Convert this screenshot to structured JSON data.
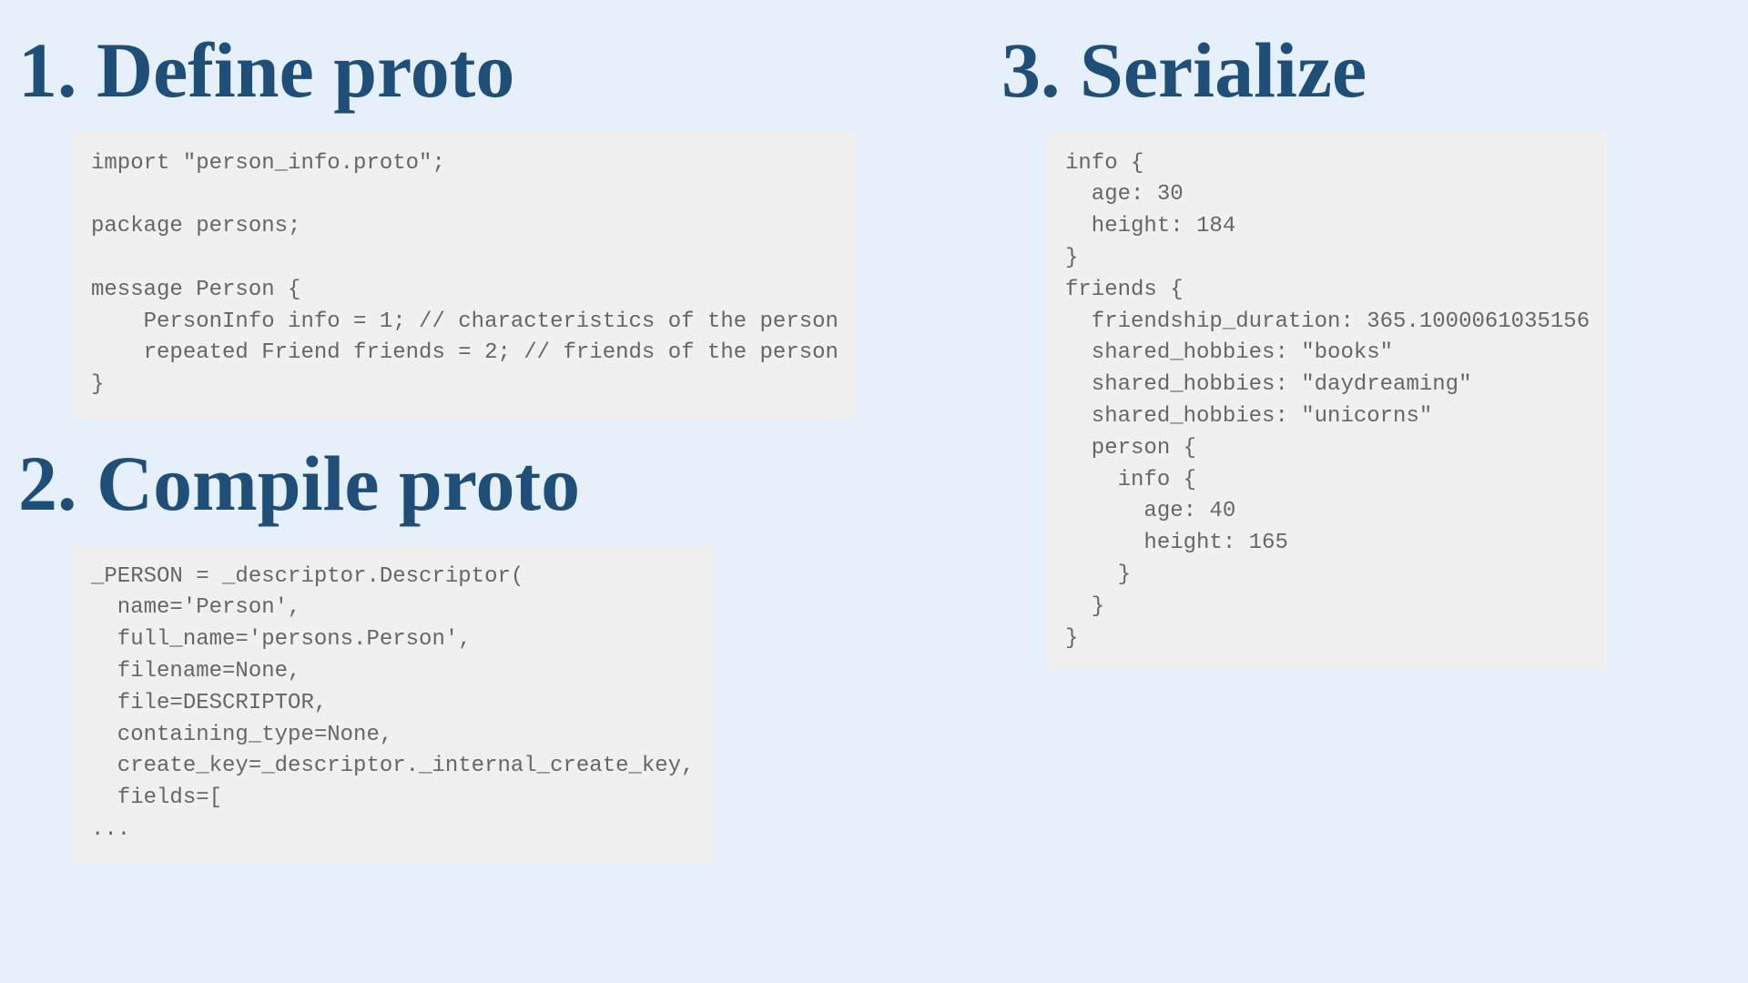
{
  "left": {
    "heading1": "1. Define proto",
    "code1": "import \"person_info.proto\";\n\npackage persons;\n\nmessage Person {\n    PersonInfo info = 1; // characteristics of the person\n    repeated Friend friends = 2; // friends of the person\n}",
    "heading2": "2. Compile proto",
    "code2": "_PERSON = _descriptor.Descriptor(\n  name='Person',\n  full_name='persons.Person',\n  filename=None,\n  file=DESCRIPTOR,\n  containing_type=None,\n  create_key=_descriptor._internal_create_key,\n  fields=[\n..."
  },
  "right": {
    "heading3": "3. Serialize",
    "code3": "info {\n  age: 30\n  height: 184\n}\nfriends {\n  friendship_duration: 365.1000061035156\n  shared_hobbies: \"books\"\n  shared_hobbies: \"daydreaming\"\n  shared_hobbies: \"unicorns\"\n  person {\n    info {\n      age: 40\n      height: 165\n    }\n  }\n}"
  }
}
